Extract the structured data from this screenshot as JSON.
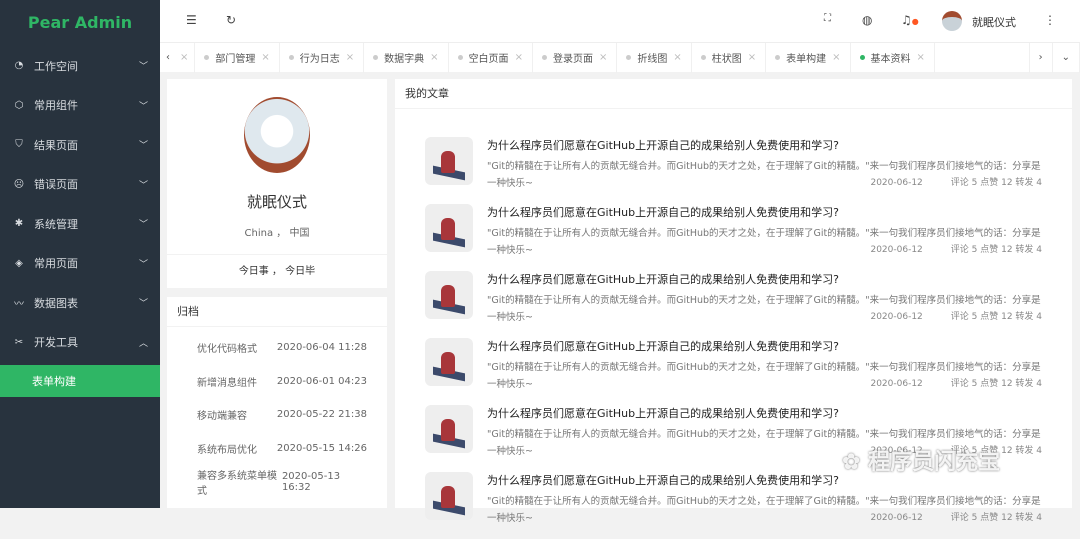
{
  "logo": "Pear Admin",
  "sidebar": {
    "items": [
      {
        "label": "工作空间",
        "icon": "dashboard-icon"
      },
      {
        "label": "常用组件",
        "icon": "cube-icon"
      },
      {
        "label": "结果页面",
        "icon": "shield-check-icon"
      },
      {
        "label": "错误页面",
        "icon": "sad-face-icon"
      },
      {
        "label": "系统管理",
        "icon": "gear-icon"
      },
      {
        "label": "常用页面",
        "icon": "layers-icon"
      },
      {
        "label": "数据图表",
        "icon": "chart-line-icon"
      },
      {
        "label": "开发工具",
        "icon": "tools-icon"
      }
    ],
    "sub_active": "表单构建"
  },
  "header": {
    "username": "就眠仪式"
  },
  "tabs": [
    {
      "label": "部门管理"
    },
    {
      "label": "行为日志"
    },
    {
      "label": "数据字典"
    },
    {
      "label": "空白页面"
    },
    {
      "label": "登录页面"
    },
    {
      "label": "折线图"
    },
    {
      "label": "柱状图"
    },
    {
      "label": "表单构建"
    },
    {
      "label": "基本资料",
      "active": true
    }
  ],
  "profile": {
    "name": "就眠仪式",
    "location": "China ， 中国",
    "motto": "今日事 ， 今日毕"
  },
  "archive": {
    "title": "归档",
    "items": [
      {
        "name": "优化代码格式",
        "date": "2020-06-04 11:28"
      },
      {
        "name": "新增消息组件",
        "date": "2020-06-01 04:23"
      },
      {
        "name": "移动端兼容",
        "date": "2020-05-22 21:38"
      },
      {
        "name": "系统布局优化",
        "date": "2020-05-15 14:26"
      },
      {
        "name": "兼容多系统菜单模式",
        "date": "2020-05-13 16:32"
      }
    ]
  },
  "articles_title": "我的文章",
  "articles": [
    {
      "title": "为什么程序员们愿意在GitHub上开源自己的成果给别人免费使用和学习?",
      "desc": "\"Git的精髓在于让所有人的贡献无缝合并。而GitHub的天才之处，在于理解了Git的精髓。\"来一句我们程序员们接地气的话：分享是一种快乐~",
      "date": "2020-06-12",
      "stats": "评论 5 点赞 12 转发 4"
    },
    {
      "title": "为什么程序员们愿意在GitHub上开源自己的成果给别人免费使用和学习?",
      "desc": "\"Git的精髓在于让所有人的贡献无缝合并。而GitHub的天才之处，在于理解了Git的精髓。\"来一句我们程序员们接地气的话：分享是一种快乐~",
      "date": "2020-06-12",
      "stats": "评论 5 点赞 12 转发 4"
    },
    {
      "title": "为什么程序员们愿意在GitHub上开源自己的成果给别人免费使用和学习?",
      "desc": "\"Git的精髓在于让所有人的贡献无缝合并。而GitHub的天才之处，在于理解了Git的精髓。\"来一句我们程序员们接地气的话：分享是一种快乐~",
      "date": "2020-06-12",
      "stats": "评论 5 点赞 12 转发 4"
    },
    {
      "title": "为什么程序员们愿意在GitHub上开源自己的成果给别人免费使用和学习?",
      "desc": "\"Git的精髓在于让所有人的贡献无缝合并。而GitHub的天才之处，在于理解了Git的精髓。\"来一句我们程序员们接地气的话：分享是一种快乐~",
      "date": "2020-06-12",
      "stats": "评论 5 点赞 12 转发 4"
    },
    {
      "title": "为什么程序员们愿意在GitHub上开源自己的成果给别人免费使用和学习?",
      "desc": "\"Git的精髓在于让所有人的贡献无缝合并。而GitHub的天才之处，在于理解了Git的精髓。\"来一句我们程序员们接地气的话：分享是一种快乐~",
      "date": "2020-06-12",
      "stats": "评论 5 点赞 12 转发 4"
    },
    {
      "title": "为什么程序员们愿意在GitHub上开源自己的成果给别人免费使用和学习?",
      "desc": "\"Git的精髓在于让所有人的贡献无缝合并。而GitHub的天才之处，在于理解了Git的精髓。\"来一句我们程序员们接地气的话：分享是一种快乐~",
      "date": "2020-06-12",
      "stats": "评论 5 点赞 12 转发 4"
    }
  ],
  "watermark": "程序员闪充宝",
  "colors": {
    "brand": "#2fb665",
    "sidebar": "#28333e",
    "notify": "#ff5722"
  }
}
